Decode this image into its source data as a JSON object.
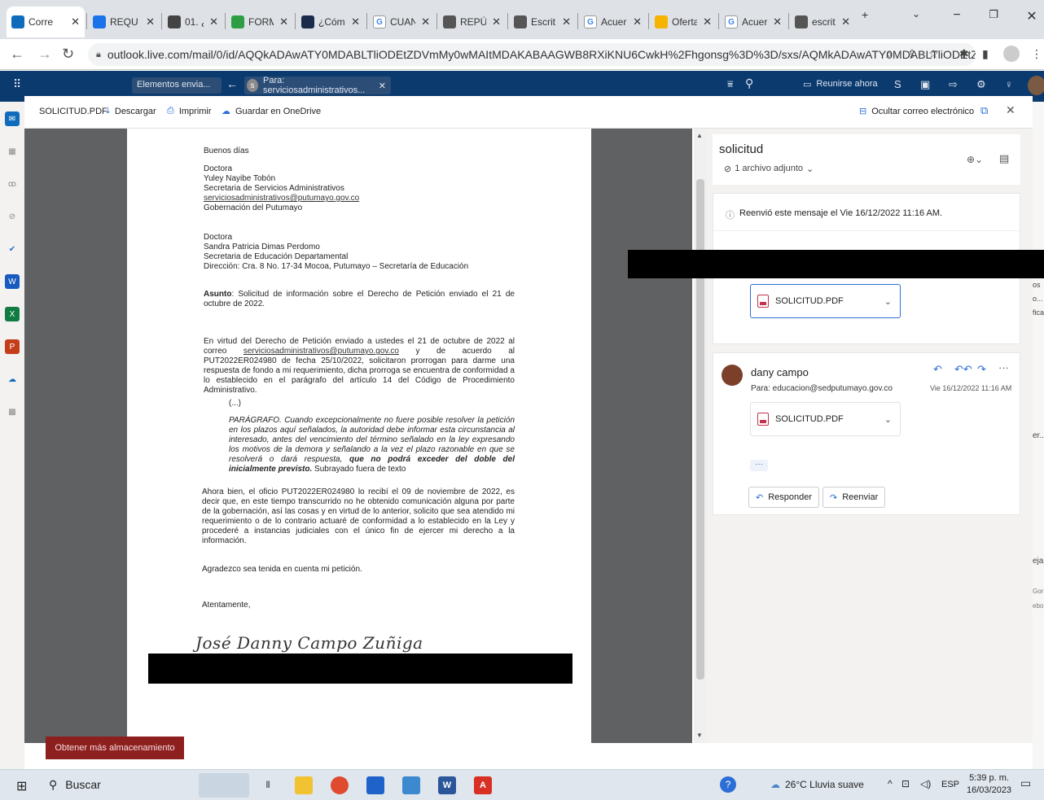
{
  "browser": {
    "tabs": [
      {
        "label": "Corre",
        "icon": "outlook-icon",
        "color": "#0f6cbd",
        "active": true
      },
      {
        "label": "REQU",
        "icon": "circle-i-icon",
        "color": "#1a73e8"
      },
      {
        "label": "01. ¿C",
        "icon": "bracket-icon",
        "color": "#444444"
      },
      {
        "label": "FORM",
        "icon": "forms-icon",
        "color": "#2e9e44"
      },
      {
        "label": "¿Cóm",
        "icon": "et-icon",
        "color": "#1a2b4c"
      },
      {
        "label": "CUAN",
        "icon": "google-icon",
        "color": "#ffffff"
      },
      {
        "label": "REPÚ",
        "icon": "globe-icon",
        "color": "#555555"
      },
      {
        "label": "Escrit",
        "icon": "globe-icon",
        "color": "#555555"
      },
      {
        "label": "Acuer",
        "icon": "google-icon",
        "color": "#ffffff"
      },
      {
        "label": "Oferta",
        "icon": "leaf-icon",
        "color": "#f4b400"
      },
      {
        "label": "Acuer",
        "icon": "google-icon",
        "color": "#ffffff"
      },
      {
        "label": "escrit",
        "icon": "globe-icon",
        "color": "#555555"
      }
    ],
    "new_tab": "+",
    "url": "outlook.live.com/mail/0/id/AQQkADAwATY0MDABLTliODEtZDVmMy0wMAItMDAKABAAGWB8RXiKNU6CwkH%2Fhgonsg%3D%3D/sxs/AQMkADAwATY0MDABLTliODEtZ..."
  },
  "outlook_topbar": {
    "folder_pill": "Elementos envia...",
    "recipient_pill": "Para: serviciosadministrativos...",
    "recipient_avatar": "s",
    "meet_now": "Reunirse ahora"
  },
  "viewer": {
    "filename": "SOLICITUD.PDF",
    "download": "Descargar",
    "print": "Imprimir",
    "save_onedrive": "Guardar en OneDrive",
    "hide_email": "Ocultar correo electrónico"
  },
  "document": {
    "greeting": "Buenos días",
    "addressee1": [
      "Doctora",
      "Yuley Nayibe Tobón",
      "Secretaria de Servicios Administrativos",
      "serviciosadministrativos@putumayo.gov.co",
      "Gobernación del Putumayo"
    ],
    "addressee2": [
      "Doctora",
      "Sandra Patricia Dimas Perdomo",
      "Secretaria de Educación Departamental",
      "Dirección: Cra. 8 No. 17-34 Mocoa, Putumayo – Secretaría de Educación"
    ],
    "subject_label": "Asunto",
    "subject_text": ": Solicitud de información sobre el Derecho de Petición enviado el 21 de octubre de 2022.",
    "para1_a": "En virtud del Derecho de Petición enviado a ustedes el 21 de octubre de 2022 al correo ",
    "para1_link": "serviciosadministrativos@putumayo.gov.co",
    "para1_b": " y de acuerdo al PUT2022ER024980 de fecha 25/10/2022, solicitaron prorrogan para darme una respuesta de fondo a mi requerimiento, dicha prorroga se encuentra de conformidad a lo establecido en el parágrafo del artículo 14 del Código de Procedimiento Administrativo.",
    "ellipsis": "(...)",
    "quote_a": "PARÁGRAFO. Cuando excepcionalmente no fuere posible resolver la petición en los plazos aquí señalados, la autoridad debe informar esta circunstancia al interesado, antes del vencimiento del término señalado en la ley expresando los motivos de la demora y señalando a la vez el plazo razonable en que se resolverá o dará respuesta,",
    "quote_bold": " que no podrá exceder del doble del inicialmente previsto.",
    "quote_c": " Subrayado fuera de texto",
    "para2": "Ahora bien, el oficio PUT2022ER024980 lo recibí el 09 de noviembre de 2022, es decir que, en este tiempo transcurrido no he obtenido comunicación alguna por parte de la gobernación, así las cosas y en virtud de lo anterior, solicito que sea atendido mi requerimiento o de lo contrario actuaré de conformidad a lo establecido en la Ley y procederé a instancias judiciales con el único fin de ejercer mi derecho a la información.",
    "thanks": "Agradezco sea tenida en cuenta mi petición.",
    "closing": "Atentamente,",
    "signature": "José Danny Campo Zuñiga"
  },
  "reading_pane": {
    "subject": "solicitud",
    "attachments_count": "1 archivo adjunto",
    "forwarded_notice": "Reenvió este mensaje el Vie 16/12/2022 11:16 AM.",
    "attachment_name": "SOLICITUD.PDF",
    "sender": "dany campo",
    "to": "Para: educacion@sedputumayo.gov.co",
    "date": "Vie 16/12/2022 11:16 AM",
    "more": "···",
    "reply": "Responder",
    "forward": "Reenviar"
  },
  "background": {
    "storage_button": "Obtener más almacenamiento",
    "right_fragments": [
      "os",
      "o...",
      "fica...",
      "er...",
      "eja",
      "Gor",
      "ebo"
    ]
  },
  "taskbar": {
    "search": "Buscar",
    "weather": "26°C  Lluvia suave",
    "lang": "ESP",
    "time": "5:39 p. m.",
    "date": "16/03/2023"
  }
}
